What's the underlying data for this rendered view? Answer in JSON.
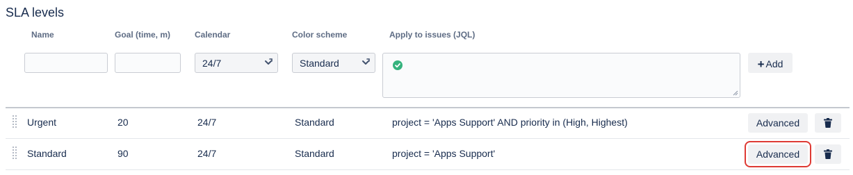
{
  "section": {
    "title": "SLA levels"
  },
  "columns": {
    "name": "Name",
    "goal": "Goal (time, m)",
    "calendar": "Calendar",
    "color_scheme": "Color scheme",
    "jql": "Apply to issues (JQL)"
  },
  "new_row": {
    "name_value": "",
    "goal_value": "",
    "calendar_selected": "24/7",
    "color_scheme_selected": "Standard",
    "jql_value": "",
    "jql_status": "valid",
    "add_label": "Add"
  },
  "rows": [
    {
      "name": "Urgent",
      "goal": "20",
      "calendar": "24/7",
      "color_scheme": "Standard",
      "jql": "project = 'Apps Support' AND priority in (High, Highest)",
      "advanced_label": "Advanced"
    },
    {
      "name": "Standard",
      "goal": "90",
      "calendar": "24/7",
      "color_scheme": "Standard",
      "jql": "project = 'Apps Support'",
      "advanced_label": "Advanced"
    }
  ],
  "icons": {
    "select_chevron": "chevron-updown-icon",
    "jql_valid": "check-circle-icon",
    "add": "plus-icon",
    "drag": "drag-handle-icon",
    "delete": "trash-icon"
  },
  "colors": {
    "valid_green": "#36b37e",
    "highlight_red": "#de3a34",
    "button_bg": "#f0f1f3",
    "text": "#172b4d",
    "header_text": "#5e6c84"
  }
}
